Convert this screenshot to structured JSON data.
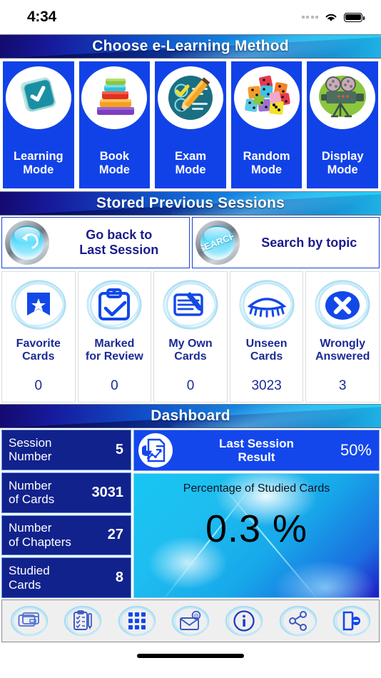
{
  "statusbar": {
    "time": "4:34",
    "wifi_icon": "wifi-icon",
    "battery_icon": "battery-icon",
    "signal_icon": "signal-dots-icon"
  },
  "sections": {
    "learning_methods_title": "Choose e-Learning Method",
    "stored_sessions_title": "Stored Previous Sessions",
    "dashboard_title": "Dashboard"
  },
  "modes": [
    {
      "label": "Learning\nMode",
      "line1": "Learning",
      "line2": "Mode",
      "icon": "check-card-icon"
    },
    {
      "label": "Book Mode",
      "line1": "Book",
      "line2": "Mode",
      "icon": "book-stack-icon"
    },
    {
      "label": "Exam Mode",
      "line1": "Exam",
      "line2": "Mode",
      "icon": "exam-checklist-pencil-icon"
    },
    {
      "label": "Random Mode",
      "line1": "Random",
      "line2": "Mode",
      "icon": "dice-icon"
    },
    {
      "label": "Display Mode",
      "line1": "Display",
      "line2": "Mode",
      "icon": "film-camera-icon"
    }
  ],
  "sessions": [
    {
      "line1": "Go back to",
      "line2": "Last Session",
      "icon": "back-arrow-icon",
      "badge": ""
    },
    {
      "line1": "Search by topic",
      "line2": "",
      "icon": "search-icon",
      "badge": "SEARCH"
    }
  ],
  "categories": [
    {
      "line1": "Favorite",
      "line2": "Cards",
      "count": "0",
      "icon": "bookmark-star-icon"
    },
    {
      "line1": "Marked",
      "line2": "for Review",
      "count": "0",
      "icon": "clipboard-check-icon"
    },
    {
      "line1": "My Own",
      "line2": "Cards",
      "count": "0",
      "icon": "note-pencil-icon"
    },
    {
      "line1": "Unseen",
      "line2": "Cards",
      "count": "3023",
      "icon": "closed-eye-icon"
    },
    {
      "line1": "Wrongly",
      "line2": "Answered",
      "count": "3",
      "icon": "circle-x-icon"
    }
  ],
  "dashboard": {
    "session_number_label_1": "Session",
    "session_number_label_2": "Number",
    "session_number_value": "5",
    "cards_label_1": "Number",
    "cards_label_2": "of Cards",
    "cards_value": "3031",
    "chapters_label_1": "Number",
    "chapters_label_2": "of Chapters",
    "chapters_value": "27",
    "studied_label_1": "Studied",
    "studied_label_2": "Cards",
    "studied_value": "8",
    "last_session_label_1": "Last Session",
    "last_session_label_2": "Result",
    "last_session_value": "50%",
    "last_session_icon": "report-chart-icon",
    "pct_title": "Percentage of Studied Cards",
    "pct_value": "0.3 %"
  },
  "toolbar": [
    {
      "icon": "cards-icon",
      "name": "flashcards"
    },
    {
      "icon": "checklist-pencil-icon",
      "name": "notes"
    },
    {
      "icon": "grid-icon",
      "name": "menu"
    },
    {
      "icon": "email-icon",
      "name": "contact"
    },
    {
      "icon": "info-icon",
      "name": "about"
    },
    {
      "icon": "share-icon",
      "name": "share"
    },
    {
      "icon": "exit-icon",
      "name": "exit"
    }
  ],
  "colors": {
    "header_dark": "#140a6e",
    "header_light": "#25d3f7",
    "mode_blue": "#1142e8",
    "navy_text": "#1b2a96",
    "stat_navy": "#11228c",
    "accent_blue": "#1347ec"
  }
}
